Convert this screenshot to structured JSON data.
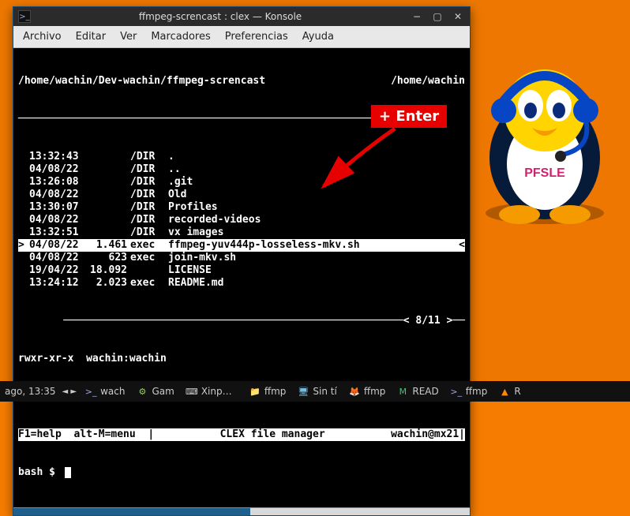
{
  "window": {
    "title": "ffmpeg-screncast : clex — Konsole",
    "icon": ">_"
  },
  "menubar": [
    "Archivo",
    "Editar",
    "Ver",
    "Marcadores",
    "Preferencias",
    "Ayuda"
  ],
  "term": {
    "path_left": "/home/wachin/Dev-wachin/ffmpeg-screncast",
    "path_right": "/home/wachin",
    "rows": [
      {
        "date": "13:32:43",
        "size": "",
        "type": "/DIR",
        "name": ".",
        "sel": false
      },
      {
        "date": "04/08/22",
        "size": "",
        "type": "/DIR",
        "name": "..",
        "sel": false
      },
      {
        "date": "13:26:08",
        "size": "",
        "type": "/DIR",
        "name": ".git",
        "sel": false
      },
      {
        "date": "04/08/22",
        "size": "",
        "type": "/DIR",
        "name": "Old",
        "sel": false
      },
      {
        "date": "13:30:07",
        "size": "",
        "type": "/DIR",
        "name": "Profiles",
        "sel": false
      },
      {
        "date": "04/08/22",
        "size": "",
        "type": "/DIR",
        "name": "recorded-videos",
        "sel": false
      },
      {
        "date": "13:32:51",
        "size": "",
        "type": "/DIR",
        "name": "vx images",
        "sel": false
      },
      {
        "date": "04/08/22",
        "size": "1.461",
        "type": "exec",
        "name": "ffmpeg-yuv444p-losseless-mkv.sh",
        "sel": true
      },
      {
        "date": "04/08/22",
        "size": "623",
        "type": "exec",
        "name": "join-mkv.sh",
        "sel": false
      },
      {
        "date": "19/04/22",
        "size": "18.092",
        "type": "",
        "name": "LICENSE",
        "sel": false
      },
      {
        "date": "13:24:12",
        "size": "2.023",
        "type": "exec",
        "name": "README.md",
        "sel": false
      }
    ],
    "counter": "< 8/11 >",
    "perms": "rwxr-xr-x  wachin:wachin",
    "footer_left": "F1=help  alt-M=menu  |",
    "footer_mid": "CLEX file manager",
    "footer_right": "wachin@mx21|",
    "prompt": "bash $ "
  },
  "annotation": "+ Enter",
  "taskbar": {
    "clock": "ago, 13:35",
    "items": [
      {
        "icon": ">_",
        "label": "wach",
        "color": "#9ad"
      },
      {
        "icon": "⚙",
        "label": "Gam",
        "color": "#9c6"
      },
      {
        "icon": "⌨",
        "label": "Xinput G",
        "color": "#ccc"
      },
      {
        "icon": "📁",
        "label": "ffmp",
        "color": "#5bf"
      },
      {
        "icon": "🖥",
        "label": "Sin tí",
        "color": "#7bd"
      },
      {
        "icon": "🦊",
        "label": "ffmp",
        "color": "#f93"
      },
      {
        "icon": "M",
        "label": "READ",
        "color": "#3c7"
      },
      {
        "icon": ">_",
        "label": "ffmp",
        "color": "#9ad"
      },
      {
        "icon": "▲",
        "label": "R",
        "color": "#f80"
      }
    ]
  },
  "mascot_text": "PFSLE"
}
